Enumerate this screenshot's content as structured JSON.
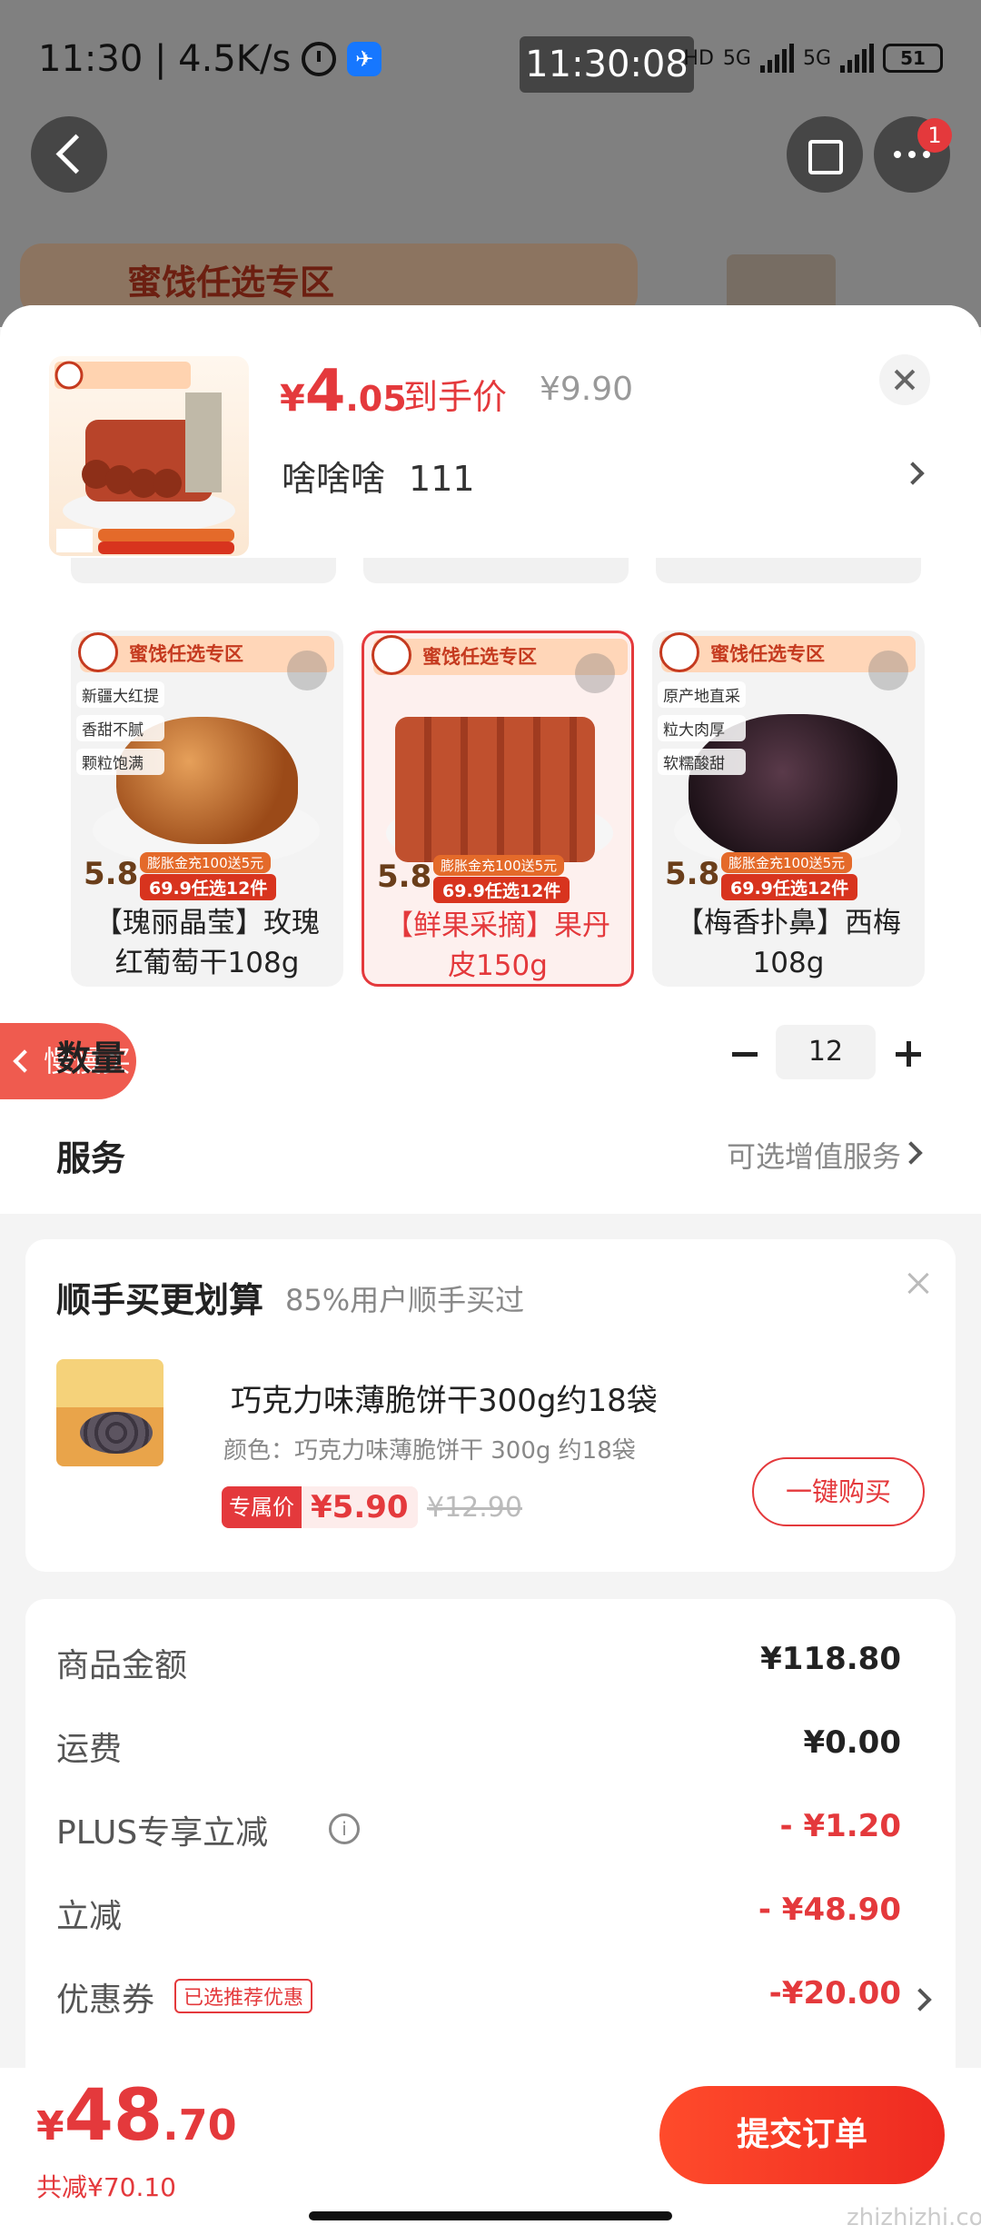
{
  "status_bar": {
    "time_speed": "11:30 | 4.5K/s",
    "clock": "11:30:08",
    "hd": "HD",
    "net1": "5G",
    "net2": "5G",
    "battery": "51"
  },
  "topnav": {
    "badge": "1",
    "banner_text": "蜜饯任选专区"
  },
  "product": {
    "price_symbol": "¥",
    "price_int": "4",
    "price_dec": ".05",
    "price_tag": "到手价",
    "orig_price": "¥9.90",
    "spec_value1": "啥啥啥",
    "spec_value2": "111"
  },
  "choices": [
    {
      "name": "【瑰丽晶莹】玫瑰红葡萄干108g",
      "header": "蜜饯任选专区",
      "tags": [
        "新疆大红提",
        "香甜不腻",
        "颗粒饱满"
      ],
      "price_mark": "5.8",
      "promo": "膨胀金充100送5元",
      "deal": "69.9任选12件",
      "selected": false
    },
    {
      "name": "【鲜果采摘】果丹皮150g",
      "header": "蜜饯任选专区",
      "tags": [],
      "price_mark": "5.8",
      "promo": "膨胀金充100送5元",
      "deal": "69.9任选12件",
      "selected": true
    },
    {
      "name": "【梅香扑鼻】西梅108g",
      "header": "蜜饯任选专区",
      "tags": [
        "原产地直采",
        "粒大肉厚",
        "软糯酸甜"
      ],
      "price_mark": "5.8",
      "promo": "膨胀金充100送5元",
      "deal": "69.9任选12件",
      "selected": false
    }
  ],
  "slow_buy": "慢慢买",
  "quantity": {
    "label": "数量",
    "value": "12"
  },
  "service": {
    "label": "服务",
    "value": "可选增值服务"
  },
  "addon": {
    "title": "顺手买更划算",
    "subtitle": "85%用户顺手买过",
    "name": "巧克力味薄脆饼干300g约18袋",
    "spec": "颜色：巧克力味薄脆饼干 300g 约18袋",
    "price_label": "专属价",
    "price": "¥5.90",
    "old_price": "¥12.90",
    "buy_label": "一键购买"
  },
  "summary": {
    "goods_label": "商品金额",
    "goods_value": "¥118.80",
    "shipping_label": "运费",
    "shipping_value": "¥0.00",
    "plus_label": "PLUS专享立减",
    "plus_value": "- ¥1.20",
    "discount_label": "立减",
    "discount_value": "- ¥48.90",
    "coupon_label": "优惠券",
    "coupon_badge": "已选推荐优惠",
    "coupon_value": "-¥20.00"
  },
  "bottom": {
    "total_symbol": "¥",
    "total_int": "48",
    "total_dec": ".70",
    "saved": "共减¥70.10",
    "submit_label": "提交订单"
  },
  "watermark": "zhizhizhi.com",
  "colors": {
    "accent": "#e4393c",
    "submit_start": "#ff4b2b",
    "submit_end": "#ee2a21"
  }
}
